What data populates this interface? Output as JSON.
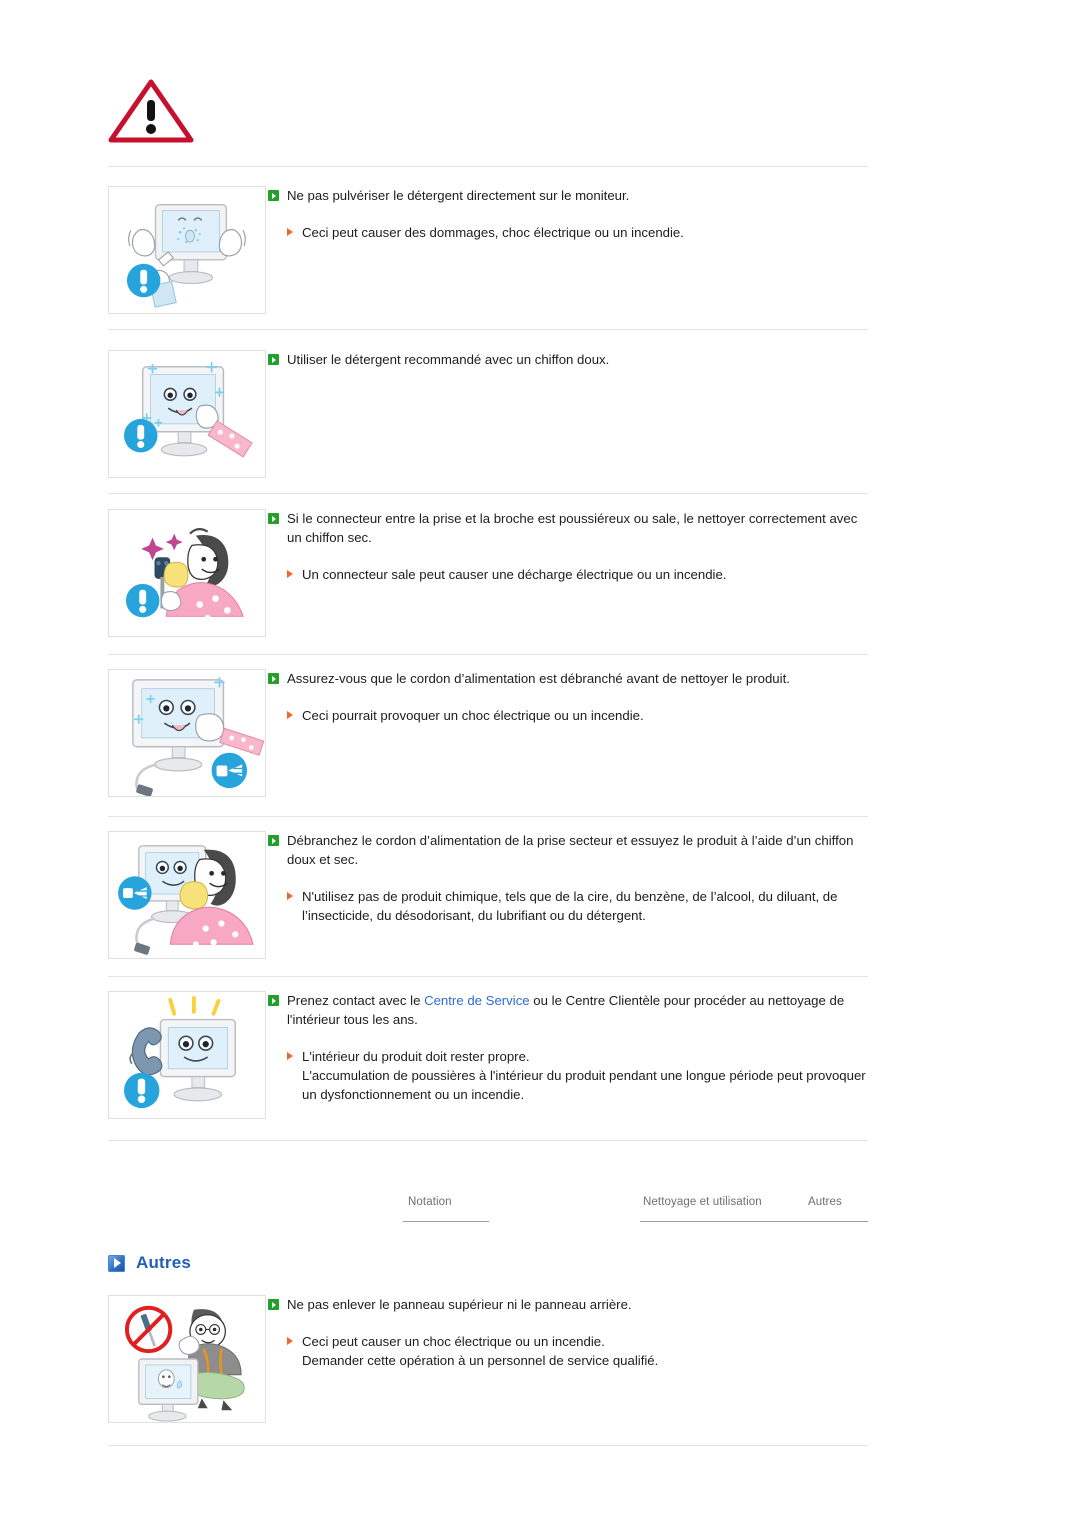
{
  "document": {
    "warning_icon": "warning-triangle-icon",
    "sections": [
      {
        "id": "cleaning",
        "items": [
          {
            "illustration": "monitor-spray-cleaner-illustration",
            "main": "Ne pas pulvériser le détergent directement sur le moniteur.",
            "subs": [
              "Ceci peut causer des dommages, choc électrique ou un incendie."
            ]
          },
          {
            "illustration": "monitor-soft-cloth-illustration",
            "main": "Utiliser le détergent recommandé avec un chiffon doux.",
            "subs": []
          },
          {
            "illustration": "woman-cleaning-plug-illustration",
            "main": "Si le connecteur entre la prise et la broche est poussiéreux ou sale, le nettoyer correctement avec un chiffon sec.",
            "subs": [
              "Un connecteur sale peut causer une décharge électrique ou un incendie."
            ]
          },
          {
            "illustration": "monitor-unplugged-cleaning-illustration",
            "main": "Assurez-vous que le cordon d’alimentation est débranché avant de nettoyer le produit.",
            "subs": [
              "Ceci pourrait provoquer un choc électrique ou un incendie."
            ]
          },
          {
            "illustration": "woman-wiping-monitor-illustration",
            "main": "Débranchez le cordon d’alimentation de la prise secteur et essuyez le produit à l’aide d’un chiffon doux et sec.",
            "subs": [
              "N'utilisez pas de produit chimique, tels que de la cire, du benzène, de l’alcool, du diluant, de l’insecticide, du désodorisant, du lubrifiant ou du détergent."
            ]
          },
          {
            "illustration": "monitor-phone-service-illustration",
            "main_prefix": "Prenez contact avec le ",
            "main_link": "Centre de Service",
            "main_suffix": " ou le Centre Clientèle pour procéder au nettoyage de l'intérieur tous les ans.",
            "subs": [
              "L'intérieur du produit doit rester propre.\nL'accumulation de poussières à l'intérieur du produit pendant une longue période peut provoquer un dysfonctionnement ou un incendie."
            ]
          }
        ]
      },
      {
        "id": "autres",
        "heading": "Autres",
        "heading_icon": "blue-arrow-square-icon",
        "items": [
          {
            "illustration": "technician-no-screwdriver-illustration",
            "main": "Ne pas enlever le panneau supérieur ni le panneau arrière.",
            "subs": [
              "Ceci peut causer un choc électrique ou un incendie.\nDemander cette opération à un personnel de service qualifié."
            ]
          }
        ]
      }
    ]
  },
  "tabs": [
    {
      "label": "Notation",
      "active": false
    },
    {
      "label": "Nettoyage et utilisation",
      "active": false
    },
    {
      "label": "Autres",
      "active": true
    }
  ],
  "colors": {
    "link": "#2a6dd6",
    "heading": "#1f5fb5",
    "main_bullet": "#22a02a",
    "sub_bullet": "#f2662a",
    "warning_red": "#c8102e",
    "rule": "#e3e3e6"
  }
}
